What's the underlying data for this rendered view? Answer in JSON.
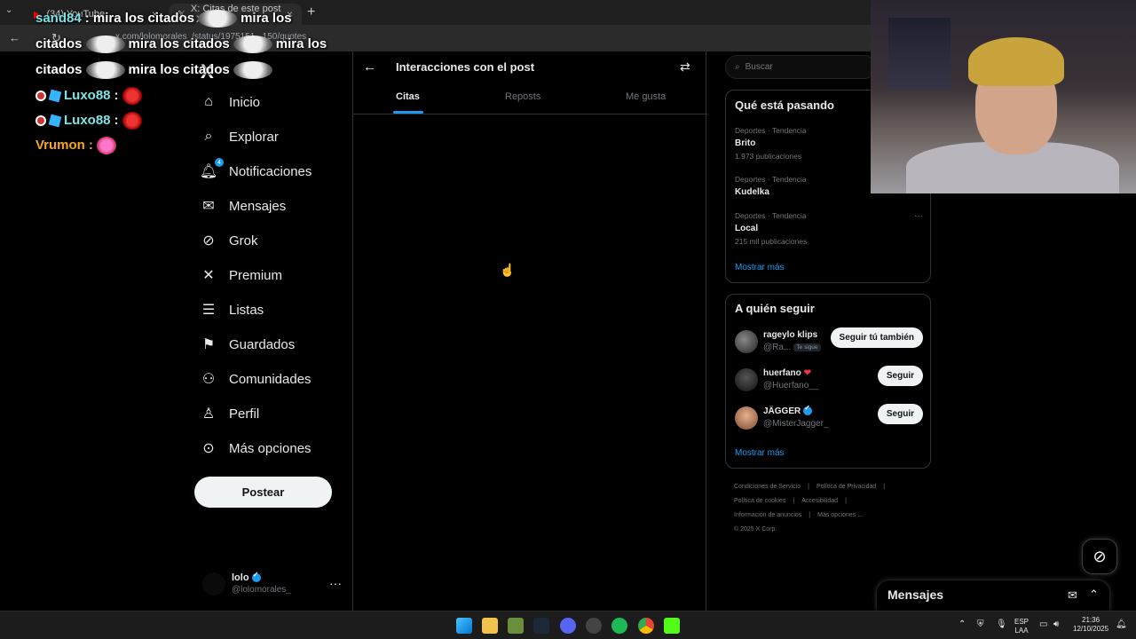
{
  "browser": {
    "tabs": [
      {
        "label": "(34) YouTube"
      },
      {
        "label": "X: Citas de este post / X"
      }
    ],
    "new_tab": "+",
    "url": "x.com/lolomorales_/status/1975151...150/quotes"
  },
  "chat": [
    {
      "user": "sand84",
      "message": ": mira los citados",
      "extra": [
        "mira los",
        "citados",
        "mira los citados",
        "mira los",
        "citados",
        "mira los citados"
      ]
    },
    {
      "user": "Luxo88",
      "sep": ":"
    },
    {
      "user": "Luxo88",
      "sep": ":"
    },
    {
      "user": "Vrumon",
      "sep": ":"
    }
  ],
  "nav": {
    "logo": "X",
    "items": [
      {
        "label": "Inicio",
        "icon": "home-icon"
      },
      {
        "label": "Explorar",
        "icon": "search-icon"
      },
      {
        "label": "Notificaciones",
        "icon": "bell-icon",
        "badge": "4"
      },
      {
        "label": "Mensajes",
        "icon": "mail-icon"
      },
      {
        "label": "Grok",
        "icon": "grok-icon"
      },
      {
        "label": "Premium",
        "icon": "x-icon"
      },
      {
        "label": "Listas",
        "icon": "list-icon"
      },
      {
        "label": "Guardados",
        "icon": "bookmark-icon"
      },
      {
        "label": "Comunidades",
        "icon": "people-icon"
      },
      {
        "label": "Perfil",
        "icon": "person-icon"
      },
      {
        "label": "Más opciones",
        "icon": "more-circle-icon"
      }
    ],
    "post_button": "Postear",
    "account": {
      "name": "lolo",
      "handle": "@lolomorales_",
      "more": "···"
    }
  },
  "main": {
    "title": "Interacciones con el post",
    "tabs": [
      "Citas",
      "Reposts",
      "Me gusta"
    ],
    "active_tab": "Citas"
  },
  "right": {
    "search_placeholder": "Buscar",
    "trends_title": "Qué está pasando",
    "trends": [
      {
        "category": "Deportes · Tendencia",
        "name": "Brito",
        "count": "1.973 publicaciones"
      },
      {
        "category": "Deportes · Tendencia",
        "name": "Kudelka",
        "count": ""
      },
      {
        "category": "Deportes · Tendencia",
        "name": "Local",
        "count": "215 mil publicaciones"
      }
    ],
    "trends_more": "···",
    "show_more": "Mostrar más",
    "follow_title": "A quién seguir",
    "follow": [
      {
        "name": "rageylo klips",
        "handle": "@Ra...",
        "follows_you": "Te sigue",
        "button": "Seguir tú también"
      },
      {
        "name": "huerfano",
        "handle": "@Huerfano__",
        "button": "Seguir"
      },
      {
        "name": "JÄGGER",
        "handle": "@MisterJagger_",
        "button": "Seguir"
      }
    ],
    "footer": [
      "Condiciones de Servicio",
      "|",
      "Política de Privacidad",
      "|",
      "Política de cookies",
      "|",
      "Accesibilidad",
      "|",
      "Información de anuncios",
      "|",
      "Más opciones ...",
      "© 2025 X Corp."
    ]
  },
  "messages_drawer": {
    "title": "Mensajes"
  },
  "taskbar": {
    "lang": "ESP",
    "lang2": "LAA",
    "time": "21:36",
    "date": "12/10/2025"
  },
  "colors": {
    "accent": "#1d9bf0",
    "background": "#000000",
    "border": "#2f3336",
    "muted": "#71767b"
  }
}
